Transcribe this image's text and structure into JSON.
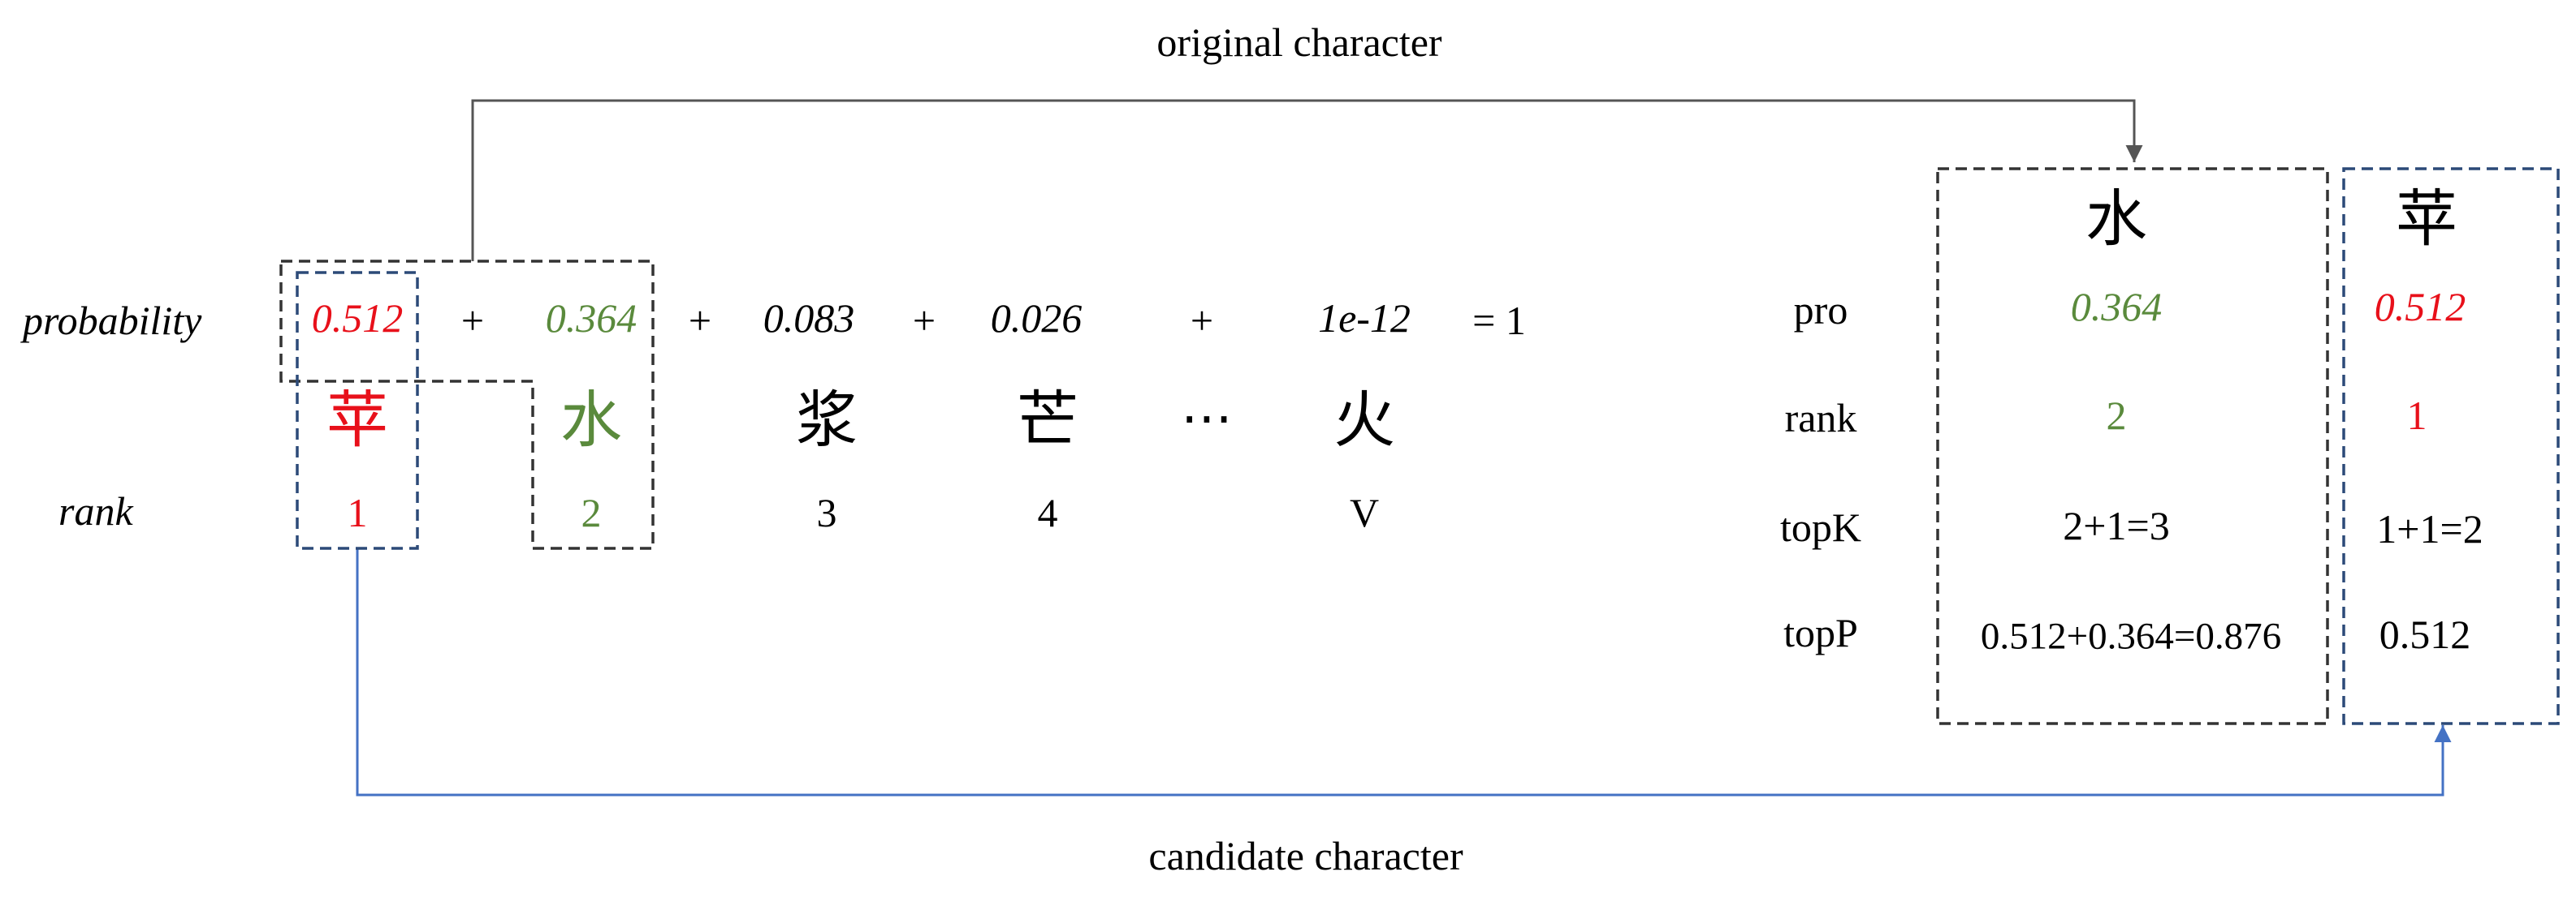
{
  "colors": {
    "highlight_red": "#e8101a",
    "highlight_green": "#5a8a3c",
    "text": "#000000",
    "box_black": "#333333",
    "box_blue": "#2c4a78",
    "arrow_gray": "#555555",
    "arrow_blue": "#4472c4"
  },
  "captions": {
    "top": "original character",
    "bottom": "candidate character"
  },
  "left": {
    "probability_label": "probability",
    "rank_label": "rank",
    "plus": "+",
    "equals": "= 1",
    "ellipsis": "⋯",
    "columns": [
      {
        "prob": "0.512",
        "char": "苹",
        "rank": "1"
      },
      {
        "prob": "0.364",
        "char": "水",
        "rank": "2"
      },
      {
        "prob": "0.083",
        "char": "浆",
        "rank": "3"
      },
      {
        "prob": "0.026",
        "char": "芒",
        "rank": "4"
      },
      {
        "prob": "1e-12",
        "char": "火",
        "rank": "V"
      }
    ]
  },
  "table": {
    "row_labels": [
      "pro",
      "rank",
      "topK",
      "topP"
    ],
    "original": {
      "char": "水",
      "pro": "0.364",
      "rank": "2",
      "topK": "2+1=3",
      "topP": "0.512+0.364=0.876"
    },
    "candidate": {
      "char": "苹",
      "pro": "0.512",
      "rank": "1",
      "topK": "1+1=2",
      "topP": "0.512"
    }
  }
}
